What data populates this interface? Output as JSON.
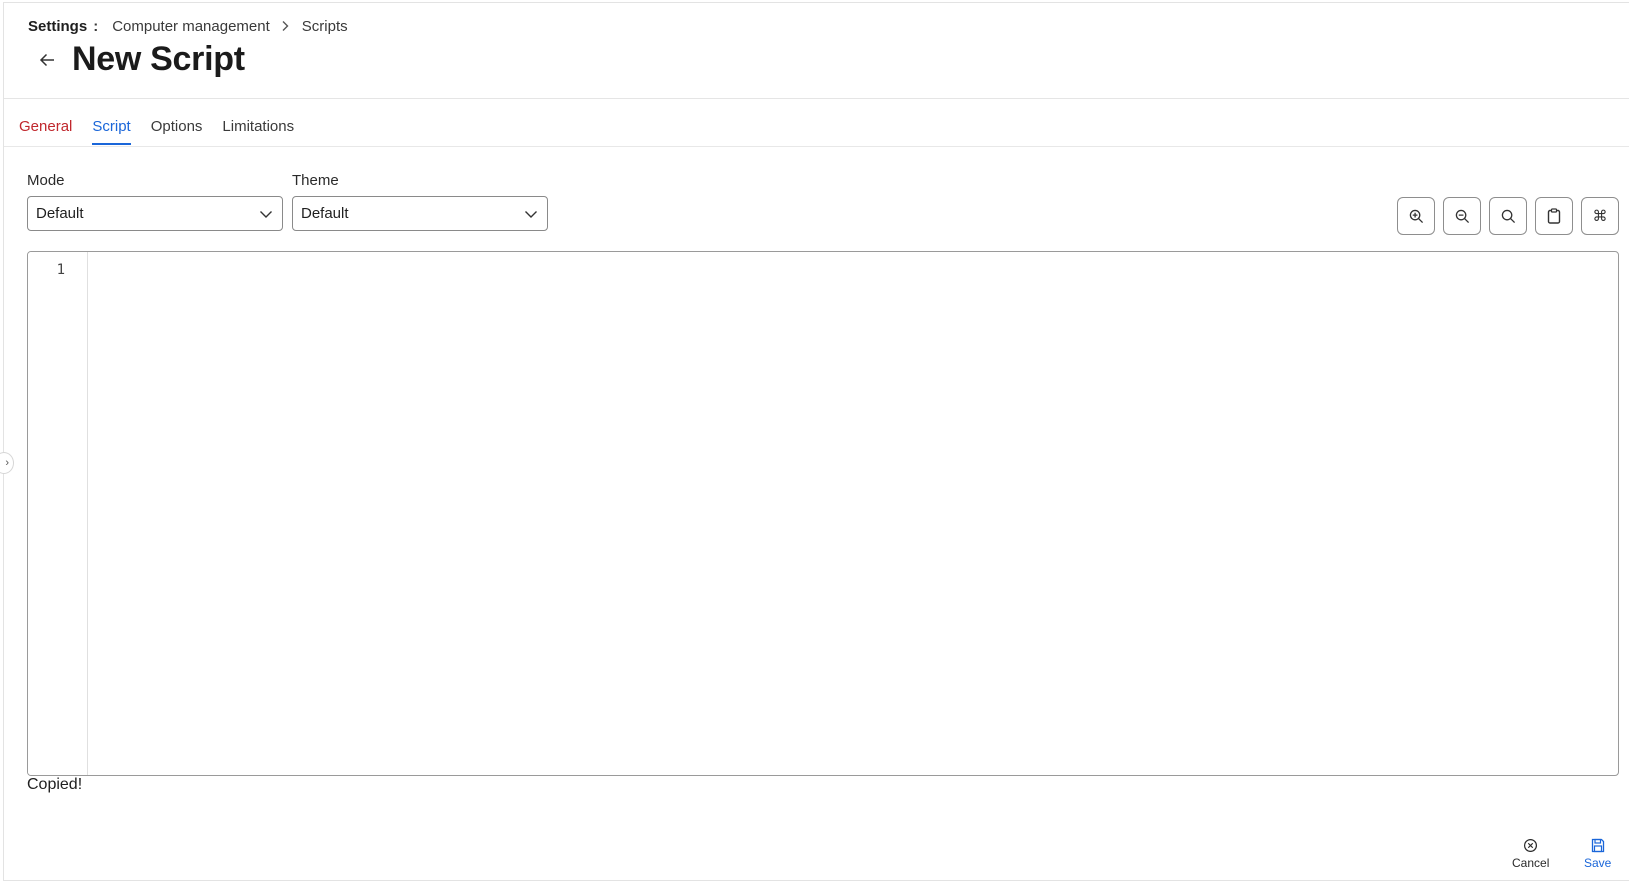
{
  "breadcrumb": {
    "root": "Settings",
    "colon": ":",
    "section": "Computer management",
    "current": "Scripts"
  },
  "page": {
    "title": "New Script"
  },
  "tabs": [
    {
      "label": "General",
      "state": "error"
    },
    {
      "label": "Script",
      "state": "active"
    },
    {
      "label": "Options",
      "state": "default"
    },
    {
      "label": "Limitations",
      "state": "default"
    }
  ],
  "mode": {
    "label": "Mode",
    "value": "Default"
  },
  "theme": {
    "label": "Theme",
    "value": "Default"
  },
  "toolbar": {
    "icons": [
      "zoom-in-icon",
      "zoom-out-icon",
      "search-icon",
      "clipboard-icon",
      "command-icon"
    ]
  },
  "editor": {
    "line_numbers": [
      "1"
    ],
    "content": ""
  },
  "status": {
    "copied_text": "Copied!"
  },
  "footer": {
    "cancel_label": "Cancel",
    "save_label": "Save"
  },
  "colors": {
    "accent": "#1a66d9",
    "error_tab": "#c0272d"
  }
}
